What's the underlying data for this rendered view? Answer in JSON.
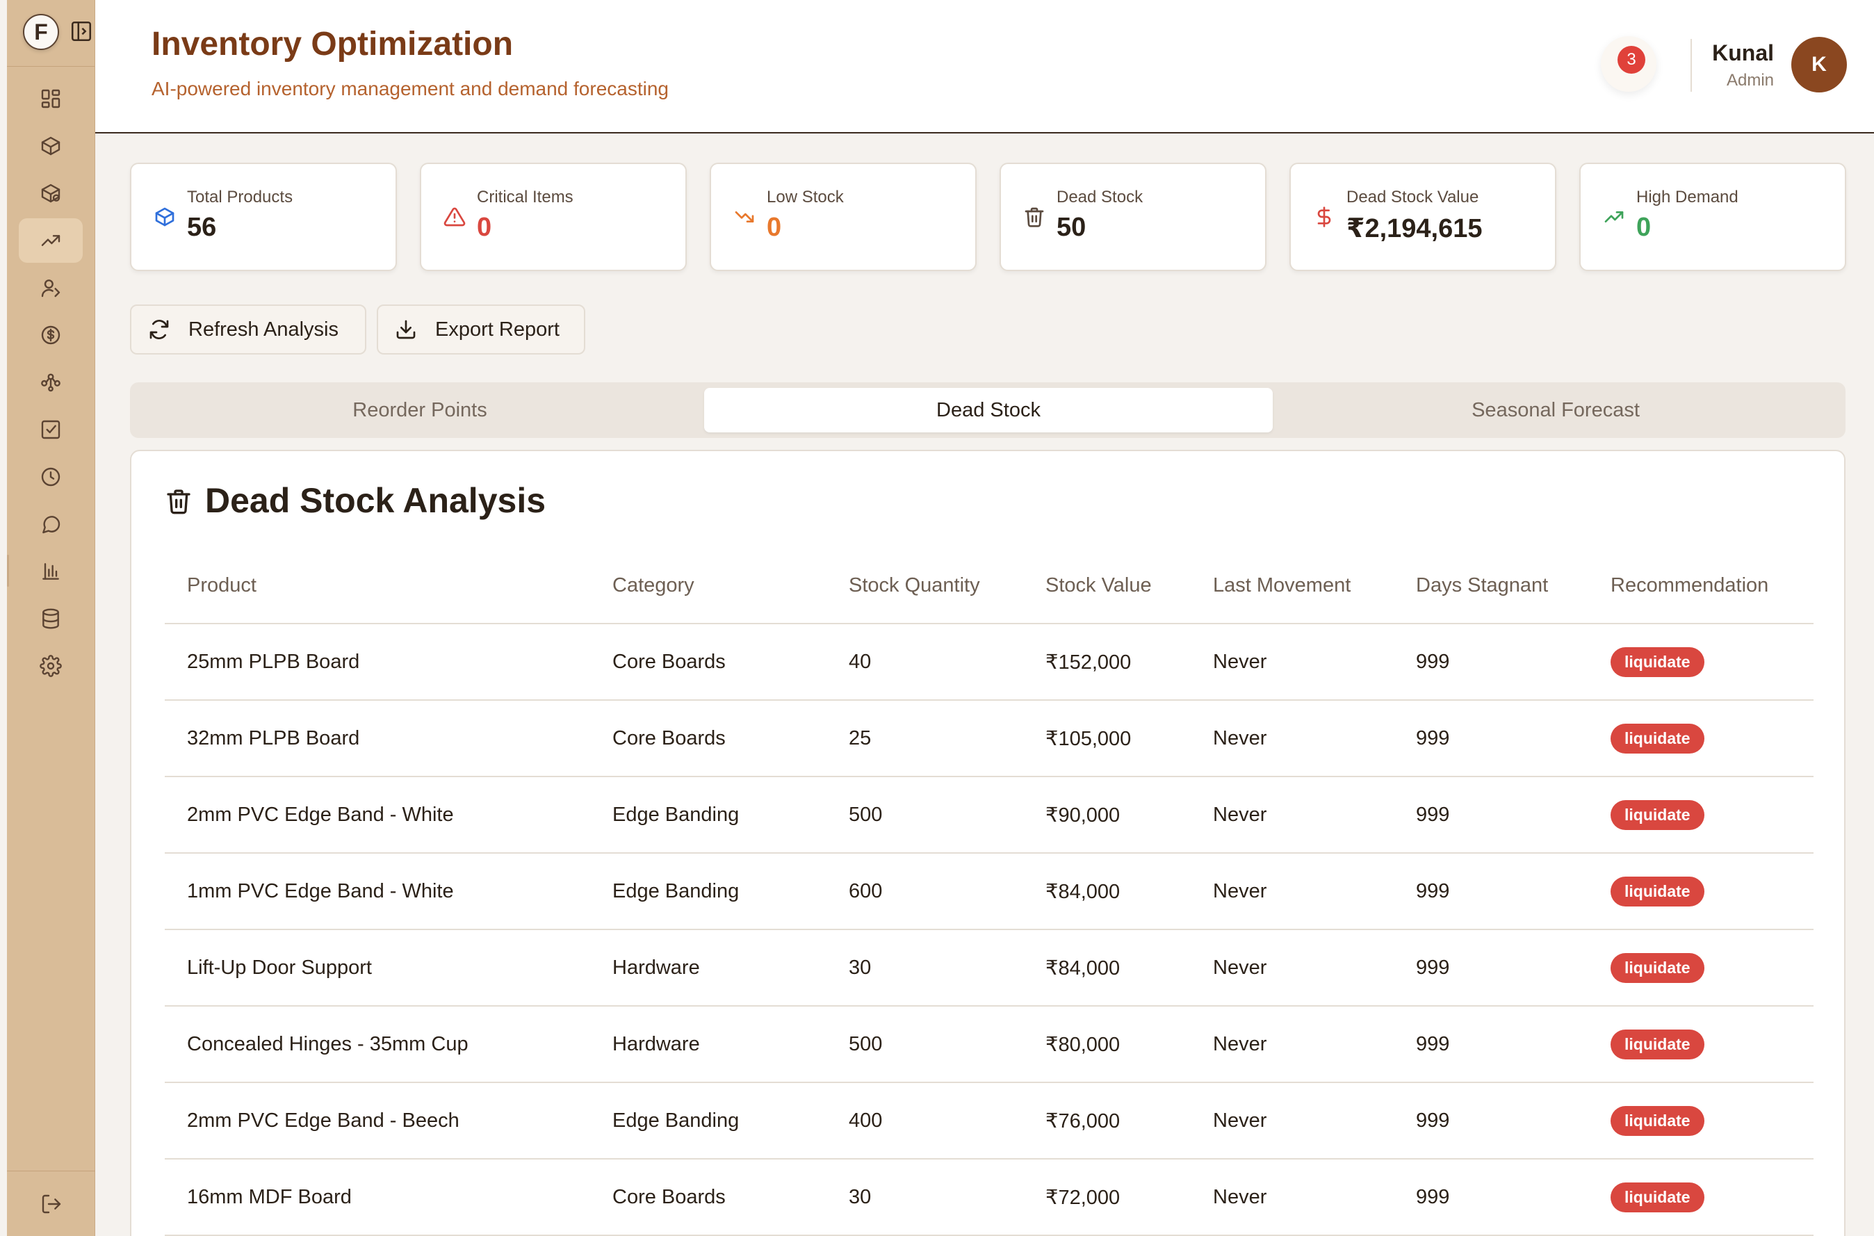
{
  "app": {
    "logo_letter": "F"
  },
  "sidebar": {
    "items": [
      {
        "icon": "dashboard-icon",
        "label": "Dashboard"
      },
      {
        "icon": "box-icon",
        "label": "Products"
      },
      {
        "icon": "boxes-icon",
        "label": "Inventory"
      },
      {
        "icon": "trending-up-icon",
        "label": "Inventory Optimization",
        "active": true
      },
      {
        "icon": "users-icon",
        "label": "Customers"
      },
      {
        "icon": "dollar-circle-icon",
        "label": "Finance"
      },
      {
        "icon": "network-icon",
        "label": "Network"
      },
      {
        "icon": "checkbox-icon",
        "label": "Tasks"
      },
      {
        "icon": "clock-icon",
        "label": "History"
      },
      {
        "icon": "chat-icon",
        "label": "Messages"
      },
      {
        "icon": "bar-chart-icon",
        "label": "Reports"
      },
      {
        "icon": "database-icon",
        "label": "Data"
      },
      {
        "icon": "gear-icon",
        "label": "Settings"
      }
    ],
    "logout_icon": "logout-icon"
  },
  "header": {
    "title": "Inventory Optimization",
    "subtitle": "AI-powered inventory management and demand forecasting",
    "notification_count": "3",
    "user_name": "Kunal",
    "user_role": "Admin",
    "avatar_letter": "K"
  },
  "stats": [
    {
      "label": "Total Products",
      "value": "56",
      "icon": "package-icon",
      "color": "#2b2118",
      "icon_color": "#2f6fdb"
    },
    {
      "label": "Critical Items",
      "value": "0",
      "icon": "alert-triangle-icon",
      "color": "#d9473f",
      "icon_color": "#d9473f"
    },
    {
      "label": "Low Stock",
      "value": "0",
      "icon": "trending-down-icon",
      "color": "#e8782c",
      "icon_color": "#e8782c"
    },
    {
      "label": "Dead Stock",
      "value": "50",
      "icon": "trash-icon",
      "color": "#2b2118",
      "icon_color": "#5b4b3f"
    },
    {
      "label": "Dead Stock Value",
      "value": "₹2,194,615",
      "icon": "dollar-icon",
      "color": "#2b2118",
      "icon_color": "#d9473f"
    },
    {
      "label": "High Demand",
      "value": "0",
      "icon": "trending-up-icon",
      "color": "#3ea35a",
      "icon_color": "#3ea35a"
    }
  ],
  "actions": {
    "refresh_label": "Refresh Analysis",
    "export_label": "Export Report"
  },
  "tabs": [
    {
      "label": "Reorder Points"
    },
    {
      "label": "Dead Stock",
      "active": true
    },
    {
      "label": "Seasonal Forecast"
    }
  ],
  "dead_stock": {
    "title": "Dead Stock Analysis",
    "columns": [
      "Product",
      "Category",
      "Stock Quantity",
      "Stock Value",
      "Last Movement",
      "Days Stagnant",
      "Recommendation"
    ],
    "rows": [
      [
        "25mm PLPB Board",
        "Core Boards",
        "40",
        "₹152,000",
        "Never",
        "999",
        "liquidate"
      ],
      [
        "32mm PLPB Board",
        "Core Boards",
        "25",
        "₹105,000",
        "Never",
        "999",
        "liquidate"
      ],
      [
        "2mm PVC Edge Band - White",
        "Edge Banding",
        "500",
        "₹90,000",
        "Never",
        "999",
        "liquidate"
      ],
      [
        "1mm PVC Edge Band - White",
        "Edge Banding",
        "600",
        "₹84,000",
        "Never",
        "999",
        "liquidate"
      ],
      [
        "Lift-Up Door Support",
        "Hardware",
        "30",
        "₹84,000",
        "Never",
        "999",
        "liquidate"
      ],
      [
        "Concealed Hinges - 35mm Cup",
        "Hardware",
        "500",
        "₹80,000",
        "Never",
        "999",
        "liquidate"
      ],
      [
        "2mm PVC Edge Band - Beech",
        "Edge Banding",
        "400",
        "₹76,000",
        "Never",
        "999",
        "liquidate"
      ],
      [
        "16mm MDF Board",
        "Core Boards",
        "30",
        "₹72,000",
        "Never",
        "999",
        "liquidate"
      ]
    ]
  }
}
